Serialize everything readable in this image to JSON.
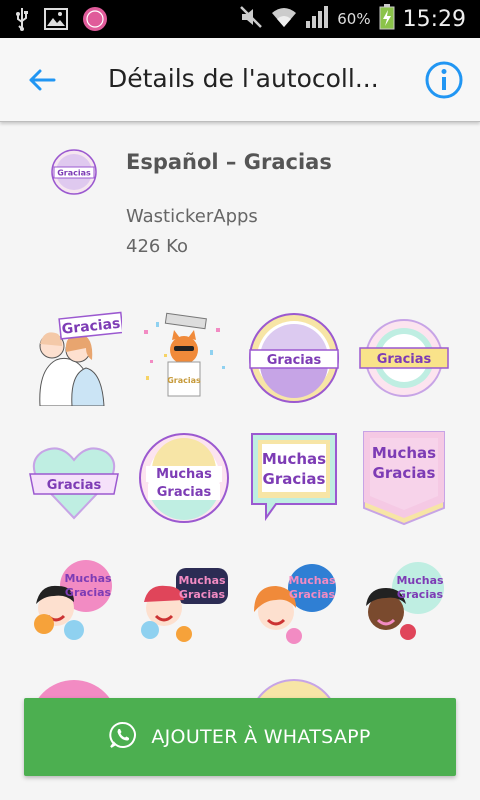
{
  "status_bar": {
    "battery_percent": "60%",
    "time": "15:29"
  },
  "app_bar": {
    "title": "Détails de l'autocoll..."
  },
  "pack": {
    "name": "Español – Gracias",
    "publisher": "WastickerApps",
    "size": "426 Ko",
    "icon_text": "Gracias"
  },
  "stickers": [
    {
      "id": "s1",
      "text": "Gracias"
    },
    {
      "id": "s2",
      "text": "Gracias"
    },
    {
      "id": "s3",
      "text": "Gracias"
    },
    {
      "id": "s4",
      "text": "Gracias"
    },
    {
      "id": "s5",
      "text": "Gracias"
    },
    {
      "id": "s6",
      "line1": "Muchas",
      "line2": "Gracias"
    },
    {
      "id": "s7",
      "line1": "Muchas",
      "line2": "Gracias"
    },
    {
      "id": "s8",
      "line1": "Muchas",
      "line2": "Gracias"
    },
    {
      "id": "s9",
      "line1": "Muchas",
      "line2": "Gracias"
    },
    {
      "id": "s10",
      "line1": "Muchas",
      "line2": "Gracias"
    },
    {
      "id": "s11",
      "line1": "Muchas",
      "line2": "Gracias"
    },
    {
      "id": "s12",
      "line1": "Muchas",
      "line2": "Gracias"
    }
  ],
  "add_button": {
    "label": "AJOUTER À WHATSAPP"
  },
  "colors": {
    "accent": "#2196f3",
    "button_green": "#4caf50",
    "sticker_purple": "#9b59d0",
    "sticker_pink": "#f7c6e0",
    "sticker_mint": "#b6ede3"
  }
}
